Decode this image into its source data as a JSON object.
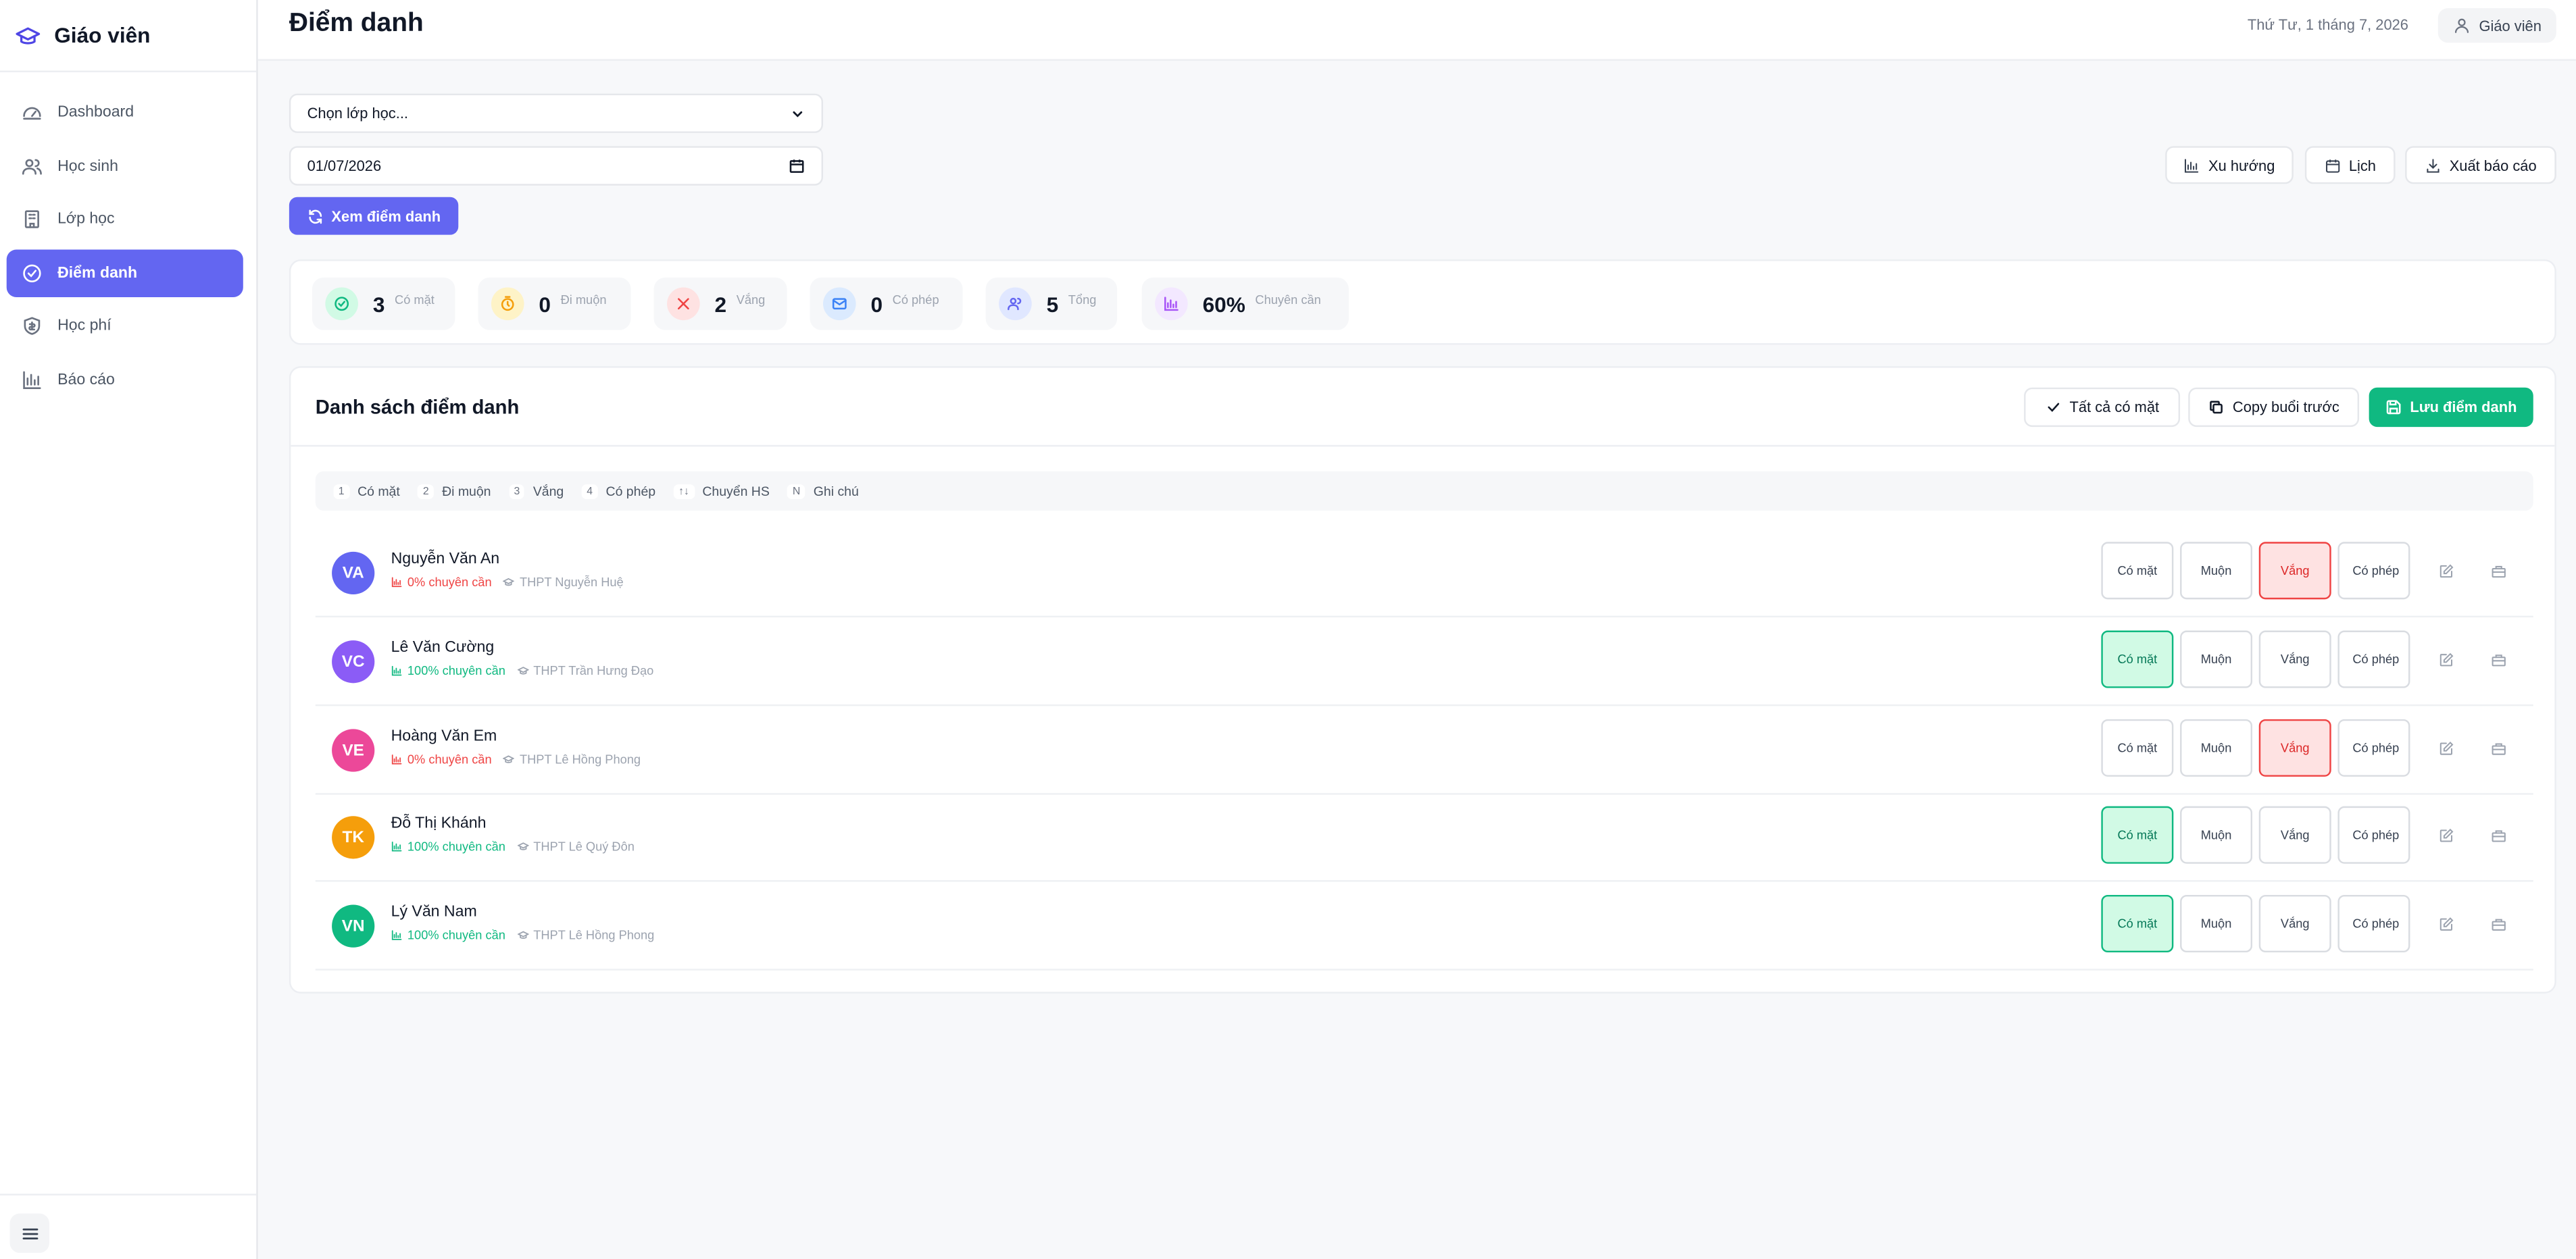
{
  "sidebar": {
    "brand": "Giáo viên",
    "items": [
      {
        "label": "Dashboard",
        "icon": "dashboard-icon"
      },
      {
        "label": "Học sinh",
        "icon": "users-icon"
      },
      {
        "label": "Lớp học",
        "icon": "building-icon"
      },
      {
        "label": "Điểm danh",
        "icon": "check-circle-icon",
        "active": true
      },
      {
        "label": "Học phí",
        "icon": "shield-icon"
      },
      {
        "label": "Báo cáo",
        "icon": "bar-chart-icon"
      }
    ]
  },
  "header": {
    "title": "Điểm danh",
    "date": "Thứ Tư, 1 tháng 7, 2026",
    "user": "Giáo viên"
  },
  "filters": {
    "class_select": "Chọn lớp học...",
    "date_value": "01/07/2026",
    "view_button": "Xem điểm danh"
  },
  "tools": {
    "trend": "Xu hướng",
    "calendar": "Lịch",
    "export": "Xuất báo cáo"
  },
  "stats": [
    {
      "value": "3",
      "label": "Có mặt",
      "color": "#10b981",
      "bg": "#d1fae5"
    },
    {
      "value": "0",
      "label": "Đi muộn",
      "color": "#f59e0b",
      "bg": "#fef3c7"
    },
    {
      "value": "2",
      "label": "Vắng",
      "color": "#ef4444",
      "bg": "#fee2e2"
    },
    {
      "value": "0",
      "label": "Có phép",
      "color": "#3b82f6",
      "bg": "#dbeafe"
    },
    {
      "value": "5",
      "label": "Tổng",
      "color": "#6366f1",
      "bg": "#e0e7ff"
    },
    {
      "value": "60%",
      "label": "Chuyên cần",
      "color": "#a855f7",
      "bg": "#f3e8ff"
    }
  ],
  "list": {
    "title": "Danh sách điểm danh",
    "all_present": "Tất cả có mặt",
    "copy_prev": "Copy buổi trước",
    "save": "Lưu điểm danh"
  },
  "shortcuts": [
    {
      "key": "1",
      "label": "Có mặt"
    },
    {
      "key": "2",
      "label": "Đi muộn"
    },
    {
      "key": "3",
      "label": "Vắng"
    },
    {
      "key": "4",
      "label": "Có phép"
    },
    {
      "key": "↑↓",
      "label": "Chuyển HS"
    },
    {
      "key": "N",
      "label": "Ghi chú"
    }
  ],
  "status_labels": {
    "present": "Có mặt",
    "late": "Muộn",
    "absent": "Vắng",
    "excused": "Có phép"
  },
  "students": [
    {
      "initials": "VA",
      "name": "Nguyễn Văn An",
      "attendance": "0% chuyên cần",
      "school": "THPT Nguyễn Huệ",
      "status": "absent",
      "avatar_color": "#6366f1"
    },
    {
      "initials": "VC",
      "name": "Lê Văn Cường",
      "attendance": "100% chuyên cần",
      "school": "THPT Trần Hưng Đạo",
      "status": "present",
      "avatar_color": "#8b5cf6"
    },
    {
      "initials": "VE",
      "name": "Hoàng Văn Em",
      "attendance": "0% chuyên cần",
      "school": "THPT Lê Hồng Phong",
      "status": "absent",
      "avatar_color": "#ec4899"
    },
    {
      "initials": "TK",
      "name": "Đỗ Thị Khánh",
      "attendance": "100% chuyên cần",
      "school": "THPT Lê Quý Đôn",
      "status": "present",
      "avatar_color": "#f59e0b"
    },
    {
      "initials": "VN",
      "name": "Lý Văn Nam",
      "attendance": "100% chuyên cần",
      "school": "THPT Lê Hồng Phong",
      "status": "present",
      "avatar_color": "#10b981"
    }
  ]
}
